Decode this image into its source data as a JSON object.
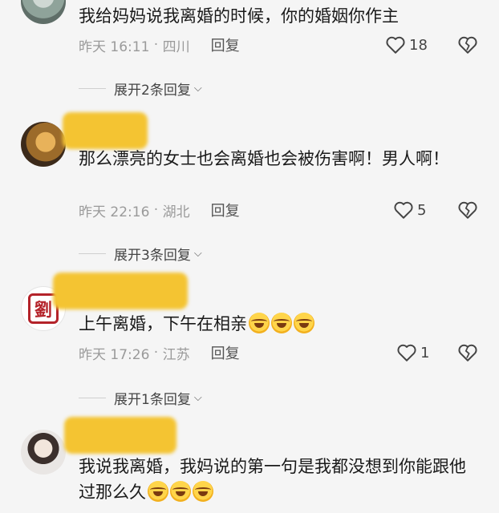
{
  "comments": [
    {
      "text": "我给妈妈说我离婚的时候，你的婚姻你作主",
      "time": "昨天 16:11",
      "location": "四川",
      "reply_label": "回复",
      "likes": "18"
    },
    {
      "text": "那么漂亮的女士也会离婚也会被伤害啊！男人啊！",
      "time": "昨天 22:16",
      "location": "湖北",
      "reply_label": "回复",
      "likes": "5"
    },
    {
      "text": "上午离婚，下午在相亲",
      "time": "昨天 17:26",
      "location": "江苏",
      "reply_label": "回复",
      "likes": "1",
      "avatar_seal": "劉"
    },
    {
      "text": "我说我离婚，我妈说的第一句是我都没想到你能跟他过那么久"
    }
  ],
  "expanders": [
    {
      "label": "展开2条回复"
    },
    {
      "label": "展开3条回复"
    },
    {
      "label": "展开1条回复"
    }
  ],
  "colors": {
    "background": "#f5f5f5",
    "redaction": "#f4c432",
    "meta_gray": "#9a9a9a"
  },
  "icons": [
    "heart-outline-icon",
    "broken-heart-icon",
    "chevron-down-icon",
    "laughing-crying-emoji"
  ]
}
